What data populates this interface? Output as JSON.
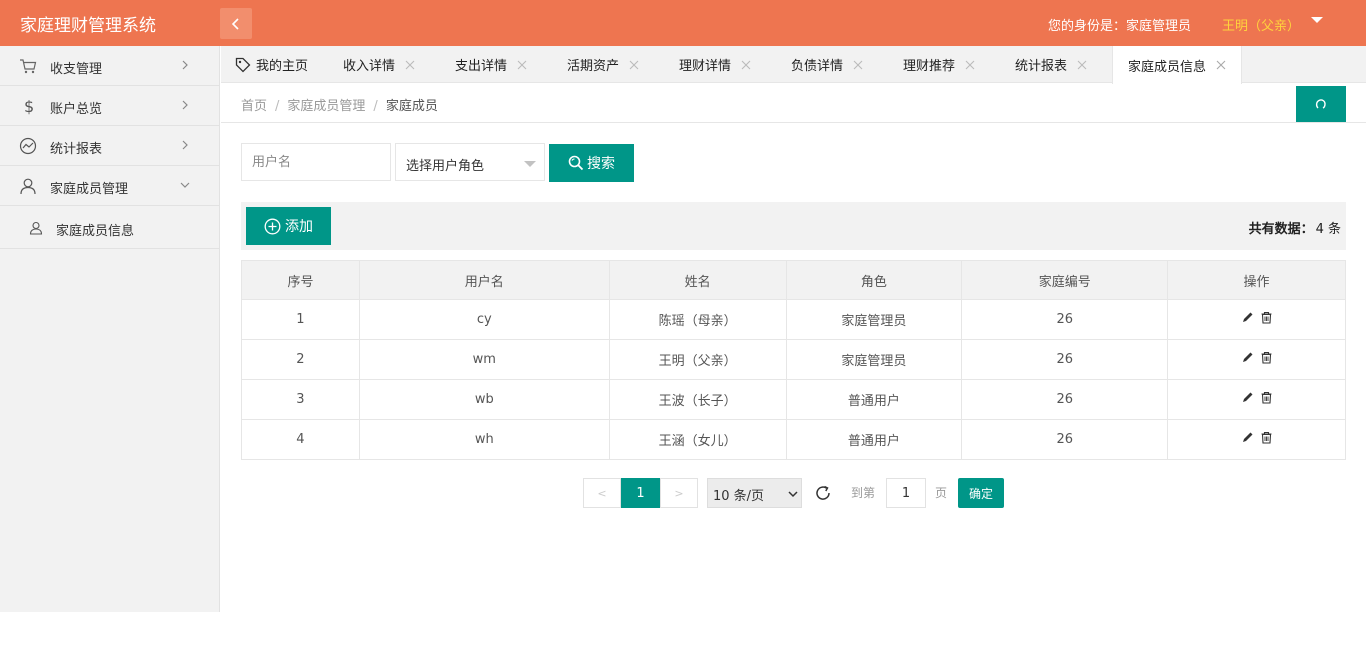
{
  "header": {
    "title": "家庭理财管理系统",
    "identity": "您的身份是：家庭管理员",
    "user": "王明（父亲）"
  },
  "sidebar": {
    "items": [
      {
        "label": "收支管理"
      },
      {
        "label": "账户总览"
      },
      {
        "label": "统计报表"
      },
      {
        "label": "家庭成员管理"
      }
    ],
    "sub_items": [
      {
        "label": "家庭成员信息"
      }
    ]
  },
  "tabs": [
    {
      "label": "我的主页"
    },
    {
      "label": "收入详情"
    },
    {
      "label": "支出详情"
    },
    {
      "label": "活期资产"
    },
    {
      "label": "理财详情"
    },
    {
      "label": "负债详情"
    },
    {
      "label": "理财推荐"
    },
    {
      "label": "统计报表"
    },
    {
      "label": "家庭成员信息"
    }
  ],
  "breadcrumb": {
    "home": "首页",
    "section": "家庭成员管理",
    "current": "家庭成员"
  },
  "search": {
    "username_placeholder": "用户名",
    "role_placeholder": "选择用户角色",
    "button": "搜索"
  },
  "toolbar": {
    "add": "添加",
    "total_label": "共有数据：",
    "total_value": "4 条"
  },
  "table": {
    "headers": [
      "序号",
      "用户名",
      "姓名",
      "角色",
      "家庭编号",
      "操作"
    ],
    "rows": [
      {
        "no": "1",
        "username": "cy",
        "name": "陈瑶（母亲）",
        "role": "家庭管理员",
        "family": "26"
      },
      {
        "no": "2",
        "username": "wm",
        "name": "王明（父亲）",
        "role": "家庭管理员",
        "family": "26"
      },
      {
        "no": "3",
        "username": "wb",
        "name": "王波（长子）",
        "role": "普通用户",
        "family": "26"
      },
      {
        "no": "4",
        "username": "wh",
        "name": "王涵（女儿）",
        "role": "普通用户",
        "family": "26"
      }
    ]
  },
  "pager": {
    "prev": "<",
    "current": "1",
    "next": ">",
    "page_size": "10 条/页",
    "goto_label": "到第",
    "goto_value": "1",
    "page_label": "页",
    "confirm": "确定"
  },
  "colors": {
    "header": "#ee7550",
    "accent": "#009688",
    "user": "#ffd33d"
  }
}
